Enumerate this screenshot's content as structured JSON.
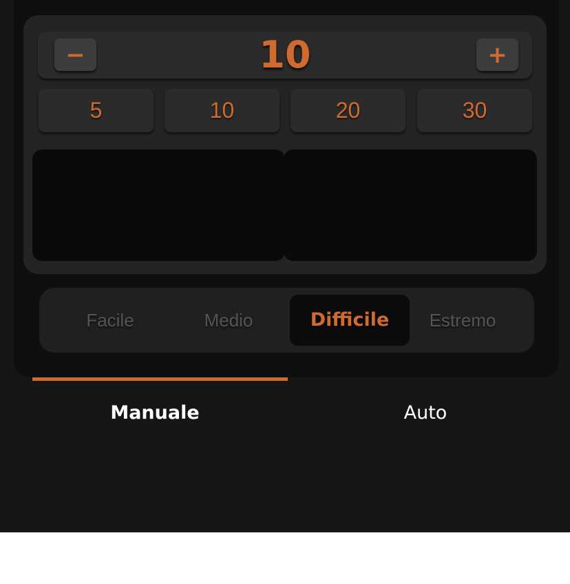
{
  "stepper": {
    "value": "10",
    "minus_label": "−",
    "plus_label": "+"
  },
  "presets": [
    "5",
    "10",
    "20",
    "30"
  ],
  "difficulty": {
    "options": [
      "Facile",
      "Medio",
      "Difficile",
      "Estremo"
    ],
    "selected": "Difficile"
  },
  "tabs": {
    "items": [
      "Manuale",
      "Auto"
    ],
    "active": "Manuale"
  },
  "colors": {
    "accent": "#d06a2f",
    "background": "#161616",
    "panel": "#242424"
  }
}
